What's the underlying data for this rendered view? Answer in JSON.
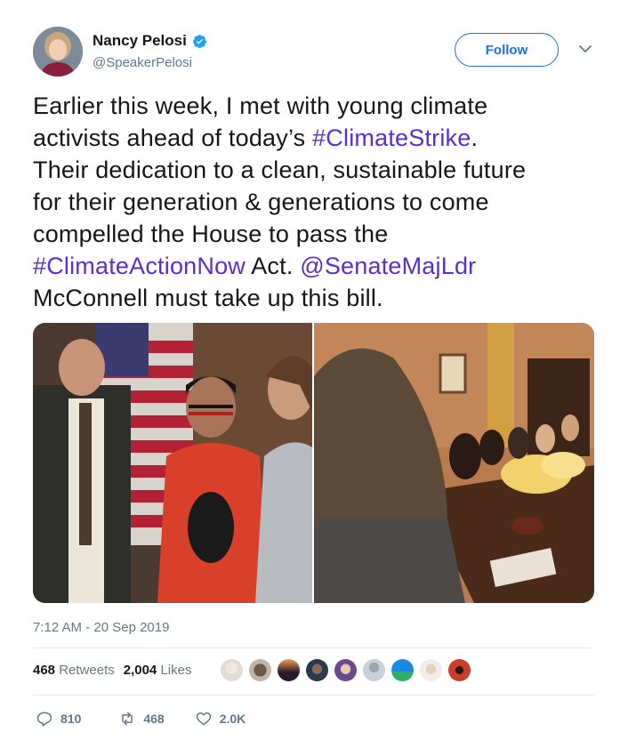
{
  "author": {
    "display_name": "Nancy Pelosi",
    "handle": "@SpeakerPelosi",
    "verified_icon": "verified-badge-icon",
    "follow_label": "Follow"
  },
  "tweet": {
    "lines": [
      [
        {
          "t": "Earlier this week, I met with young climate",
          "link": false
        }
      ],
      [
        {
          "t": "activists ahead of today’s ",
          "link": false
        },
        {
          "t": "#ClimateStrike",
          "link": true
        },
        {
          "t": ".",
          "link": false
        }
      ],
      [
        {
          "t": "Their dedication to a clean, sustainable future",
          "link": false
        }
      ],
      [
        {
          "t": "for their generation & generations to come",
          "link": false
        }
      ],
      [
        {
          "t": "compelled the House to pass the",
          "link": false
        }
      ],
      [
        {
          "t": "#ClimateActionNow",
          "link": true
        },
        {
          "t": " Act. ",
          "link": false
        },
        {
          "t": "@SenateMajLdr",
          "link": true
        }
      ],
      [
        {
          "t": "McConnell must take up this bill.",
          "link": false
        }
      ]
    ],
    "timestamp": "7:12 AM - 20 Sep 2019"
  },
  "stats": {
    "retweets_count": "468",
    "retweets_label": "Retweets",
    "likes_count": "2,004",
    "likes_label": "Likes"
  },
  "actions": {
    "replies": "810",
    "retweets": "468",
    "likes": "2.0K"
  },
  "colors": {
    "link": "#5a2ed1",
    "follow": "#1b6ef3",
    "muted": "#657786",
    "verified": "#1da1f2"
  }
}
